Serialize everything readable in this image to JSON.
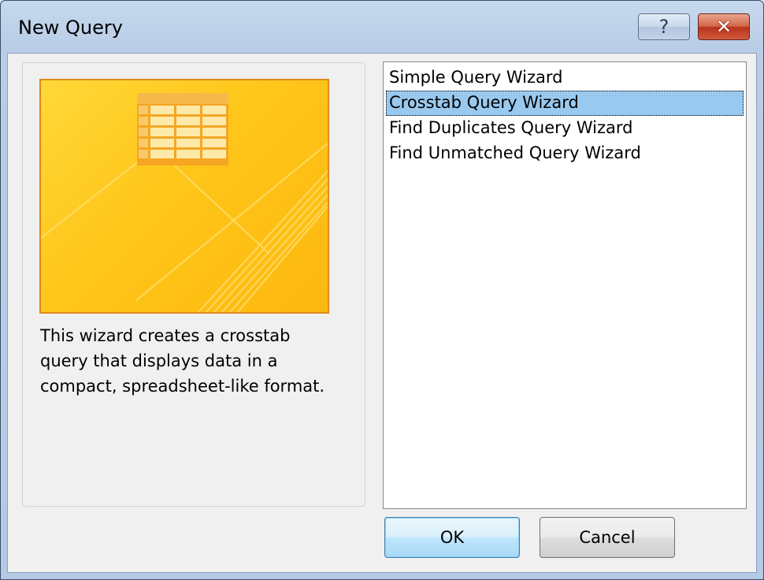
{
  "window": {
    "title": "New Query",
    "help_label": "?",
    "close_label": "✕"
  },
  "description": "This wizard creates a crosstab\nquery that displays data in a\ncompact, spreadsheet-like format.",
  "wizards": {
    "items": [
      {
        "label": "Simple Query Wizard",
        "selected": false
      },
      {
        "label": "Crosstab Query Wizard",
        "selected": true
      },
      {
        "label": "Find Duplicates Query Wizard",
        "selected": false
      },
      {
        "label": "Find Unmatched Query Wizard",
        "selected": false
      }
    ]
  },
  "buttons": {
    "ok_label": "OK",
    "cancel_label": "Cancel"
  },
  "colors": {
    "preview_border": "#e08a1a",
    "preview_fill": "#ffc61a",
    "selection": "#99c9ef"
  },
  "icons": {
    "preview": "crosstab-table-icon",
    "help": "question-mark-icon",
    "close": "close-icon"
  }
}
